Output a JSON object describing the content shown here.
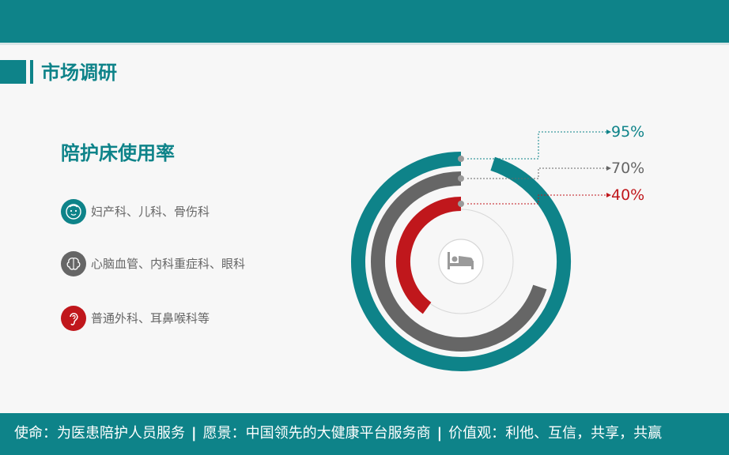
{
  "section": {
    "title": "市场调研"
  },
  "card": {
    "title": "陪护床使用率"
  },
  "categories": [
    {
      "label": "妇产科、儿科、骨伤科",
      "icon": "baby-face-icon",
      "color": "#0e8389"
    },
    {
      "label": "心脑血管、内科重症科、眼科",
      "icon": "brain-icon",
      "color": "#666666"
    },
    {
      "label": "普通外科、耳鼻喉科等",
      "icon": "ear-icon",
      "color": "#c0171c"
    }
  ],
  "chart_data": {
    "type": "radial-bar",
    "center_icon": "bed-icon",
    "series": [
      {
        "value": 95,
        "label": "95%",
        "color": "#0e8389"
      },
      {
        "value": 70,
        "label": "70%",
        "color": "#666666"
      },
      {
        "value": 40,
        "label": "40%",
        "color": "#c0171c"
      }
    ]
  },
  "footer": {
    "mission": "使命：为医患陪护人员服务",
    "vision": "愿景：中国领先的大健康平台服务商",
    "values": "价值观：利他、互信，共享，共赢",
    "separator": "|"
  }
}
